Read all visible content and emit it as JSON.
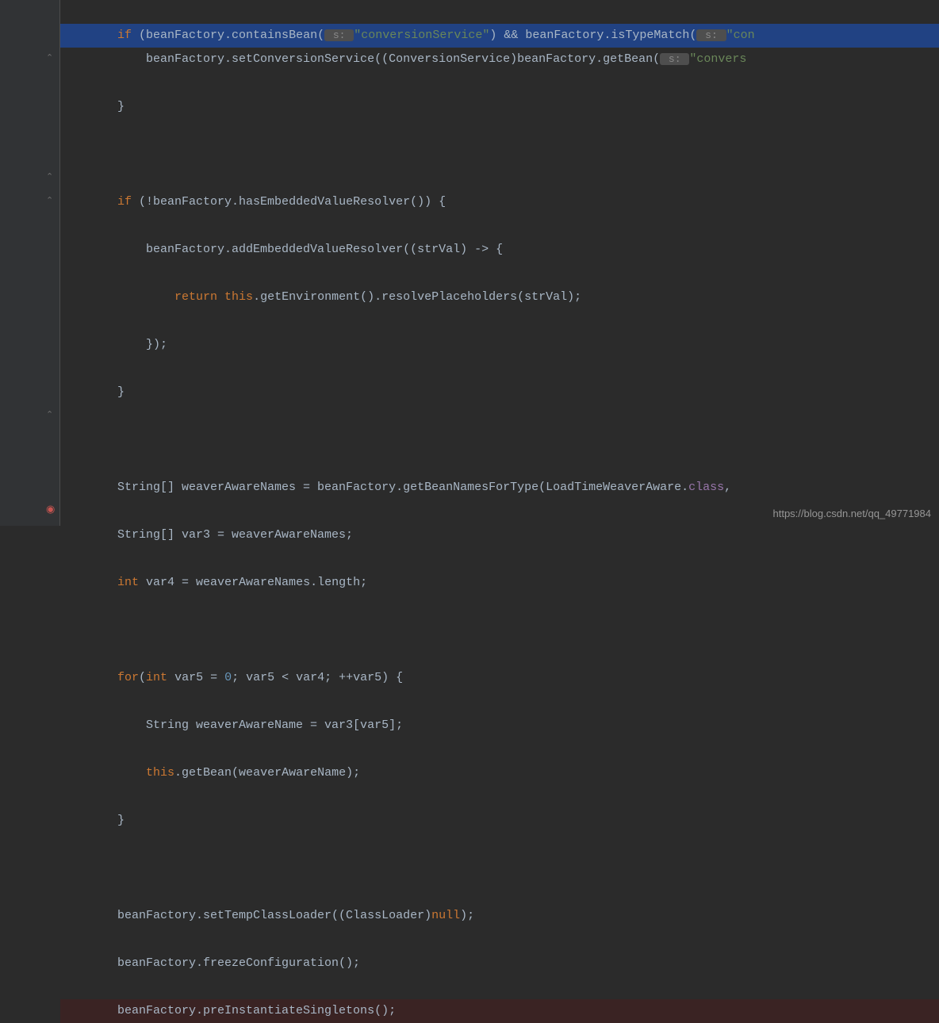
{
  "code": {
    "l1_kw": "if",
    "l1_a": " (beanFactory.containsBean(",
    "l1_hint1": " s: ",
    "l1_str1": "\"conversionService\"",
    "l1_b": ") && beanFactory.isTypeMatch(",
    "l1_hint2": " s: ",
    "l1_str2": "\"con",
    "l2_a": "            beanFactory.setConversionService((ConversionService)beanFactory.getBean(",
    "l2_hint": " s: ",
    "l2_str": "\"convers",
    "l3": "        }",
    "l5_kw": "if",
    "l5_a": " (!beanFactory.hasEmbeddedValueResolver()) {",
    "l6": "            beanFactory.addEmbeddedValueResolver((strVal) -> {",
    "l7_kw1": "return",
    "l7_kw2": " this",
    "l7_a": ".getEnvironment().resolvePlaceholders(strVal);",
    "l8": "            });",
    "l9": "        }",
    "l11_a": "        String[] weaverAwareNames = beanFactory.getBeanNamesForType(LoadTimeWeaverAware.",
    "l11_fld": "class",
    "l11_b": ",",
    "l12": "        String[] var3 = weaverAwareNames;",
    "l13_kw": "int",
    "l13_a": " var4 = weaverAwareNames.length;",
    "l15_kw1": "for",
    "l15_a": "(",
    "l15_kw2": "int",
    "l15_b": " var5 = ",
    "l15_num": "0",
    "l15_c": "; var5 < var4; ++var5) {",
    "l16": "            String weaverAwareName = var3[var5];",
    "l17_kw": "this",
    "l17_a": ".getBean(weaverAwareName);",
    "l18": "        }",
    "l20_a": "        beanFactory.setTempClassLoader((ClassLoader)",
    "l20_kw": "null",
    "l20_b": ");",
    "l21": "        beanFactory.freezeConfiguration();",
    "l22": "        beanFactory.preInstantiateSingletons();"
  },
  "gutter": {
    "fold_up": "⌃",
    "stop": "◉"
  },
  "watermark": "https://blog.csdn.net/qq_49771984"
}
